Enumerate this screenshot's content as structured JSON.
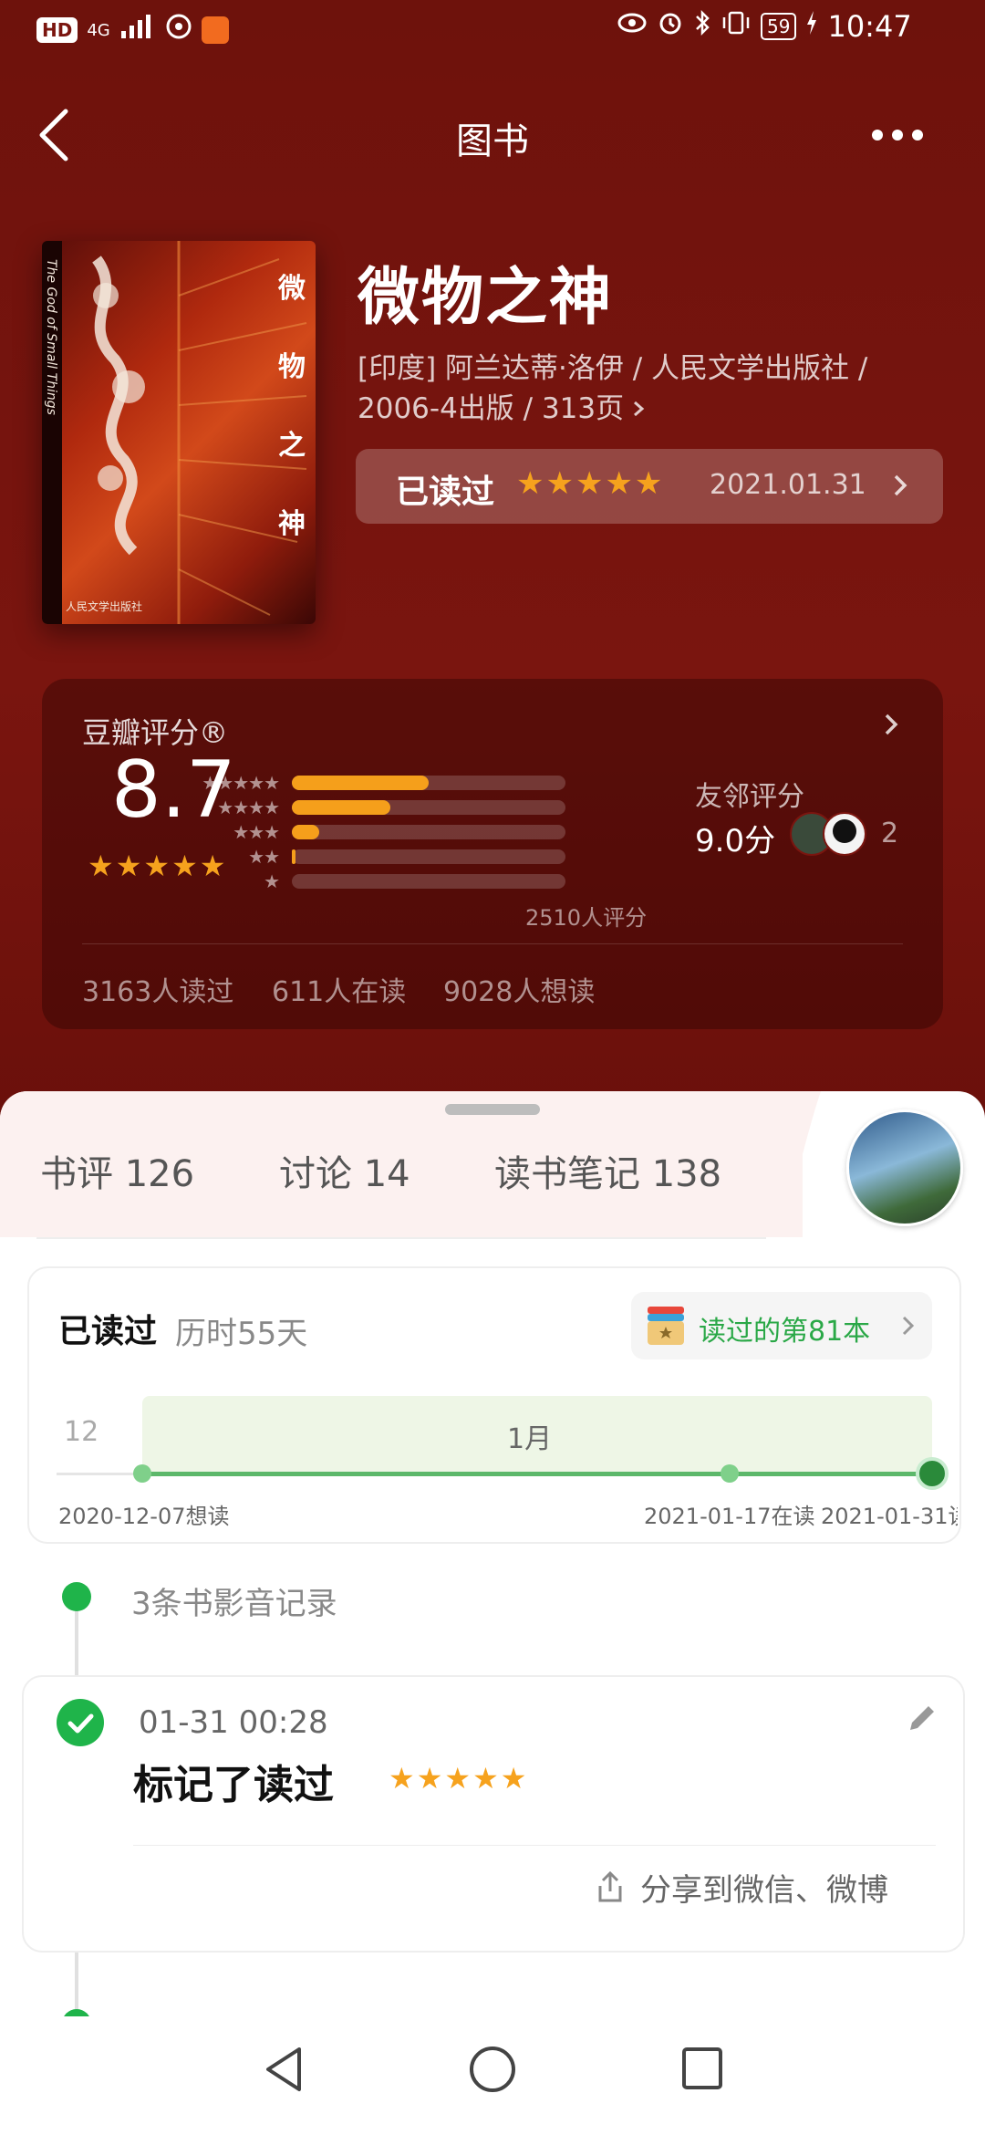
{
  "status_bar": {
    "left_badges": [
      "HD",
      "4G"
    ],
    "battery": "59",
    "time": "10:47"
  },
  "header": {
    "title": "图书"
  },
  "book": {
    "title": "微物之神",
    "meta_line1": "[印度] 阿兰达蒂·洛伊 / 人民文学出版社 /",
    "meta_line2": "2006-4出版 / 313页",
    "status_label": "已读过",
    "status_date": "2021.01.31",
    "cover_vertical_title": [
      "微",
      "物",
      "之",
      "神"
    ],
    "cover_spine_text": "The God of Small Things",
    "cover_bottom_text": "人民文学出版社"
  },
  "rating": {
    "label": "豆瓣评分®",
    "score": "8.7",
    "stars": "★★★★★",
    "count_text": "2510人评分",
    "distribution": [
      {
        "stars": 5,
        "fraction": 0.5
      },
      {
        "stars": 4,
        "fraction": 0.36
      },
      {
        "stars": 3,
        "fraction": 0.1
      },
      {
        "stars": 2,
        "fraction": 0.01
      },
      {
        "stars": 1,
        "fraction": 0.0
      }
    ],
    "friend_label": "友邻评分",
    "friend_score": "9.0分",
    "friend_count": "2",
    "read_count": "3163人读过",
    "reading_count": "611人在读",
    "want_count": "9028人想读"
  },
  "tabs": [
    {
      "label": "书评 126"
    },
    {
      "label": "讨论 14"
    },
    {
      "label": "读书笔记 138"
    }
  ],
  "progress_card": {
    "status": "已读过",
    "duration": "历时55天",
    "badge": "读过的第81本",
    "month_left": "12",
    "month_main": "1月",
    "start_label": "2020-12-07想读",
    "mid_label": "2021-01-17在读",
    "end_label": "2021-01-31读"
  },
  "records": {
    "summary": "3条书影音记录",
    "item": {
      "time": "01-31 00:28",
      "action": "标记了读过",
      "share": "分享到微信、微博"
    }
  },
  "colors": {
    "hero_bg": "#751410",
    "star": "#f6a21d",
    "accent_green": "#2aa847"
  }
}
